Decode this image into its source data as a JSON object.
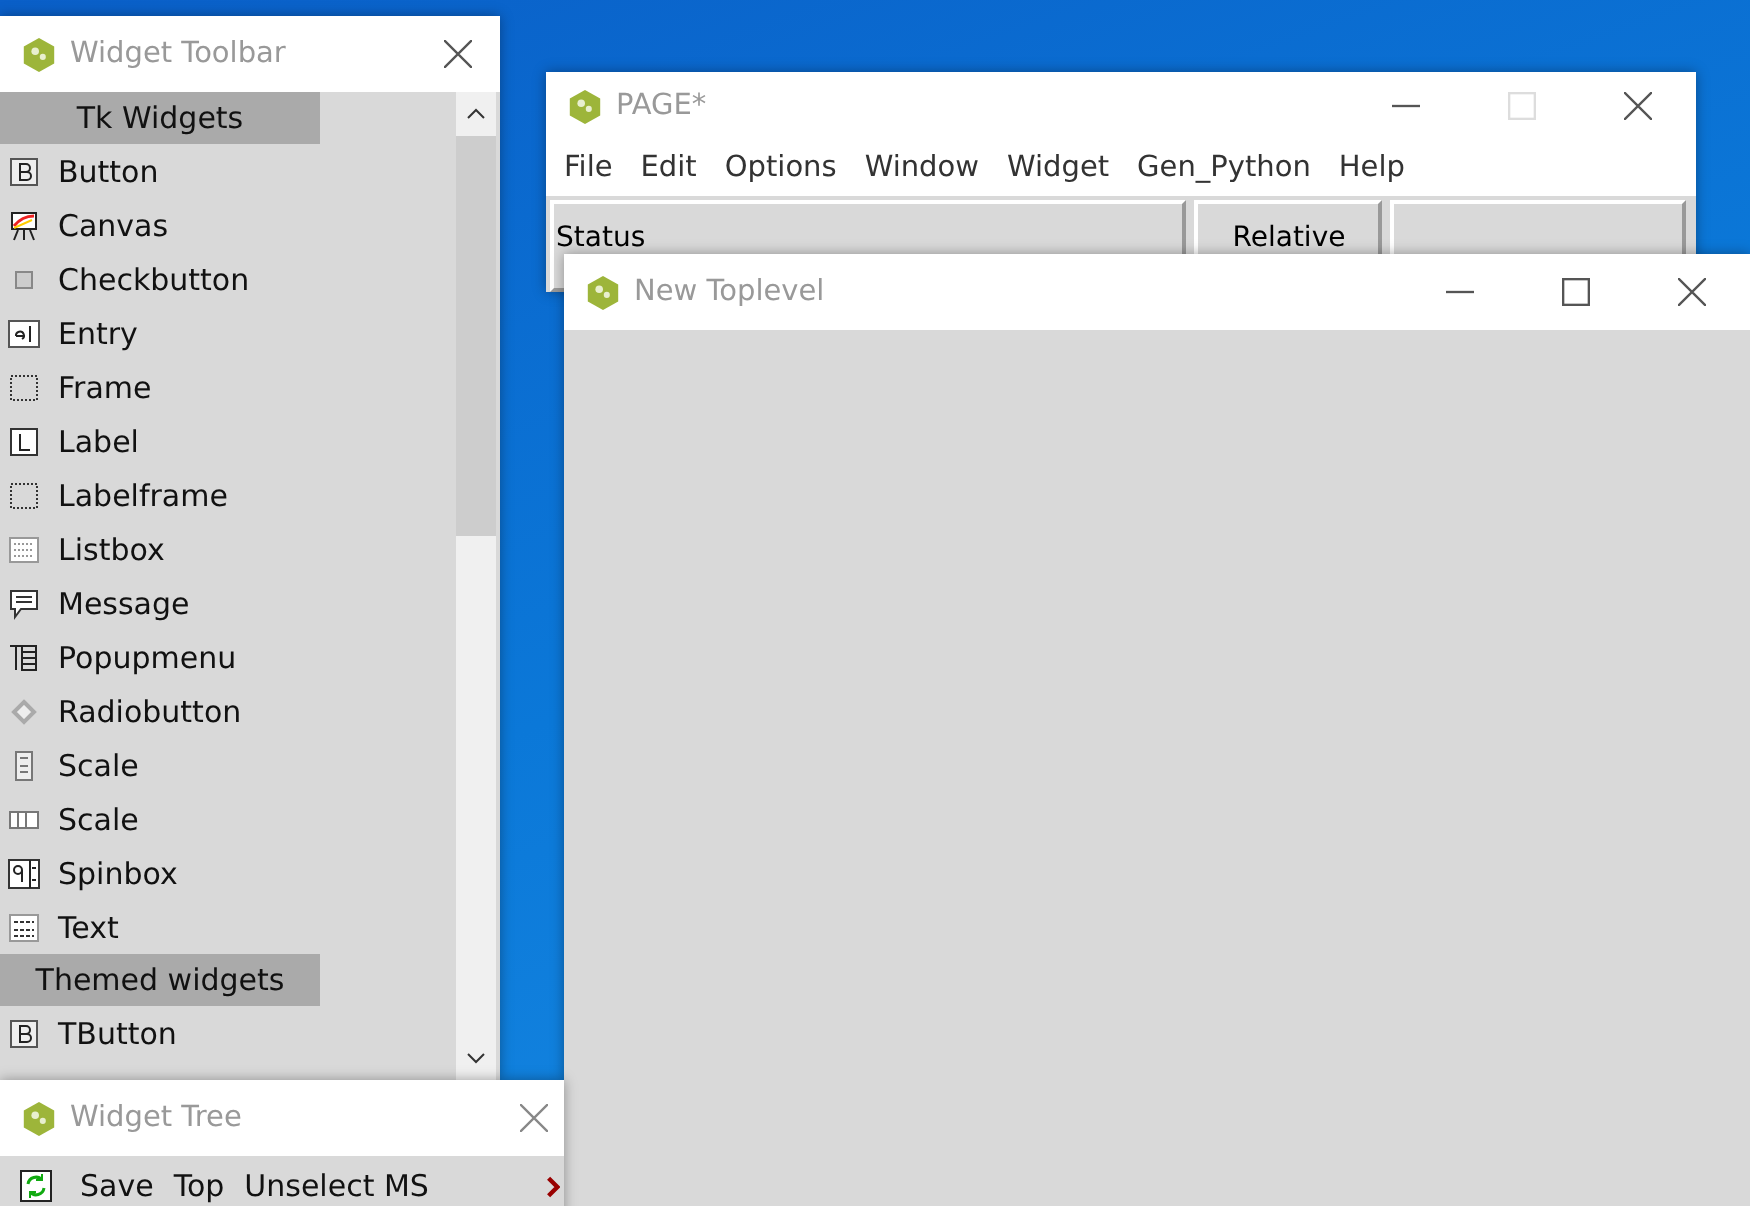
{
  "widget_toolbar": {
    "title": "Widget Toolbar",
    "sections": [
      {
        "heading": "Tk Widgets",
        "items": [
          "Button",
          "Canvas",
          "Checkbutton",
          "Entry",
          "Frame",
          "Label",
          "Labelframe",
          "Listbox",
          "Message",
          "Popupmenu",
          "Radiobutton",
          "Scale",
          "Scale",
          "Spinbox",
          "Text"
        ]
      },
      {
        "heading": "Themed widgets",
        "items": [
          "TButton"
        ]
      }
    ]
  },
  "page_window": {
    "title": "PAGE*",
    "menu": [
      "File",
      "Edit",
      "Options",
      "Window",
      "Widget",
      "Gen_Python",
      "Help"
    ],
    "status_cells": [
      "Status",
      "Relative"
    ]
  },
  "toplevel": {
    "title": "New Toplevel"
  },
  "widget_tree": {
    "title": "Widget Tree",
    "toolbar": [
      "Save",
      "Top",
      "Unselect MS"
    ]
  }
}
